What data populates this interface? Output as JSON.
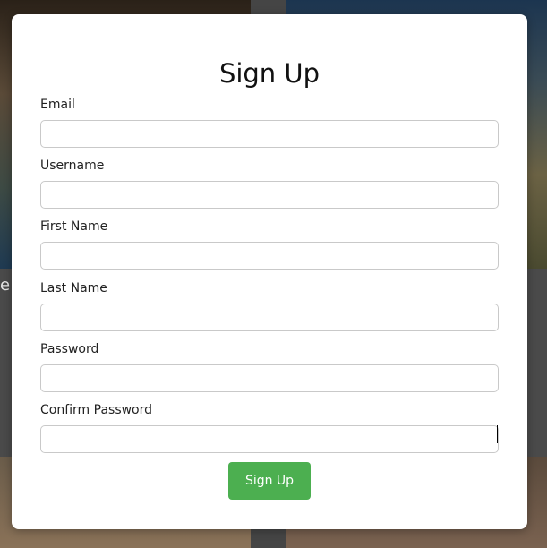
{
  "background": {
    "partial_text": "e"
  },
  "modal": {
    "title": "Sign Up",
    "fields": [
      {
        "label": "Email",
        "value": "",
        "placeholder": ""
      },
      {
        "label": "Username",
        "value": "",
        "placeholder": ""
      },
      {
        "label": "First Name",
        "value": "",
        "placeholder": ""
      },
      {
        "label": "Last Name",
        "value": "",
        "placeholder": ""
      },
      {
        "label": "Password",
        "value": "",
        "placeholder": ""
      },
      {
        "label": "Confirm Password",
        "value": "",
        "placeholder": ""
      }
    ],
    "submit_label": "Sign Up"
  },
  "colors": {
    "button": "#4caf50",
    "input_border": "#c9c9c9"
  }
}
